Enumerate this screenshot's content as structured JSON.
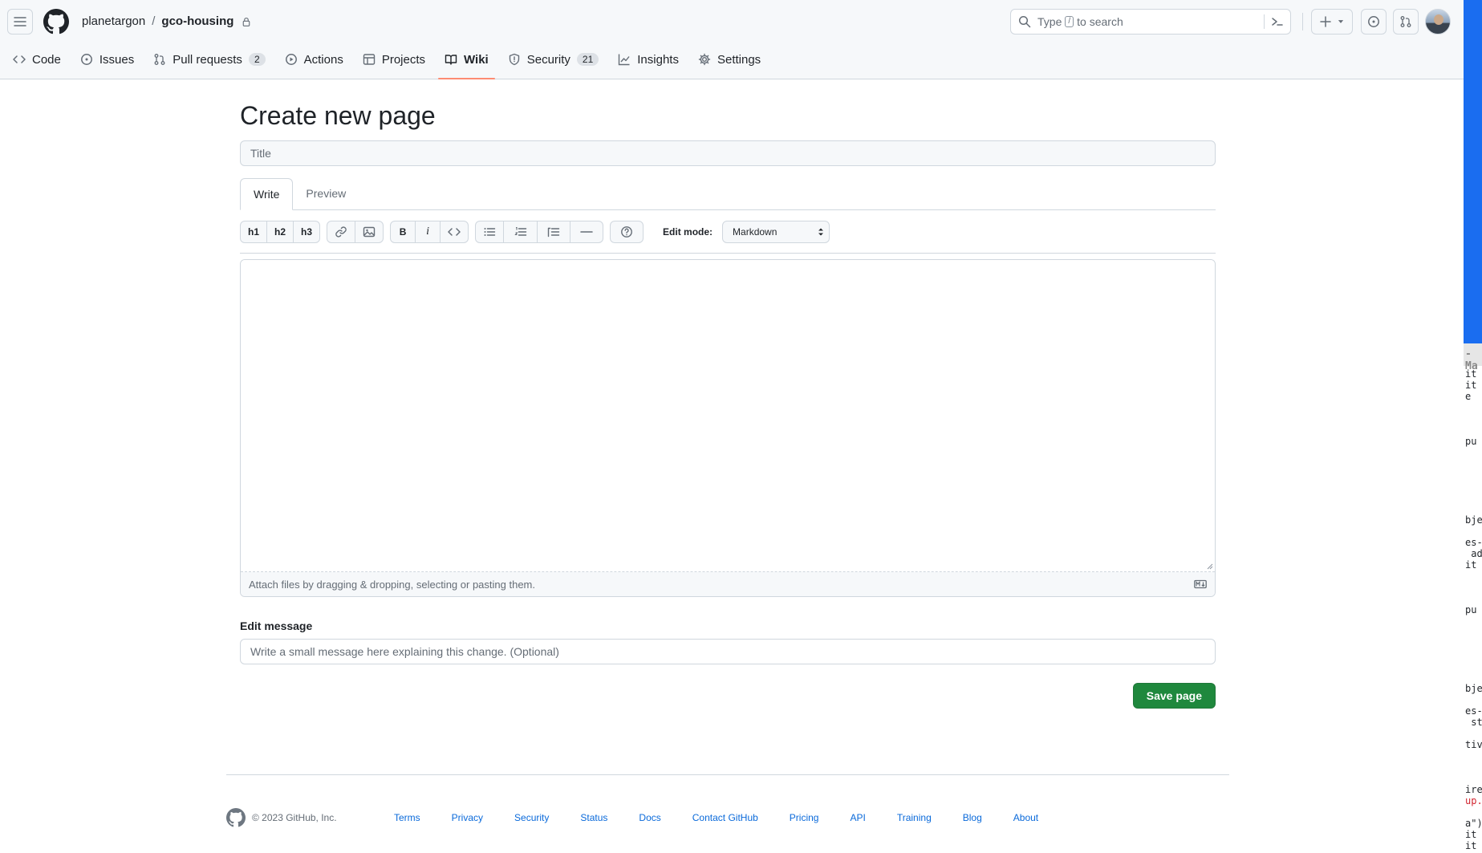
{
  "header": {
    "owner": "planetargon",
    "separator": "/",
    "repo": "gco-housing",
    "search": {
      "prefix": "Type",
      "key": "/",
      "suffix": "to search"
    }
  },
  "tabs": [
    {
      "label": "Code",
      "icon": "code-icon"
    },
    {
      "label": "Issues",
      "icon": "issue-icon"
    },
    {
      "label": "Pull requests",
      "icon": "pull-request-icon",
      "count": "2"
    },
    {
      "label": "Actions",
      "icon": "play-icon"
    },
    {
      "label": "Projects",
      "icon": "table-icon"
    },
    {
      "label": "Wiki",
      "icon": "book-icon",
      "selected": true
    },
    {
      "label": "Security",
      "icon": "shield-icon",
      "count": "21"
    },
    {
      "label": "Insights",
      "icon": "graph-icon"
    },
    {
      "label": "Settings",
      "icon": "gear-icon"
    }
  ],
  "main": {
    "title": "Create new page",
    "title_placeholder": "Title",
    "editor_tabs": {
      "write": "Write",
      "preview": "Preview"
    },
    "toolbar": {
      "h1": "h1",
      "h2": "h2",
      "h3": "h3",
      "bold": "B",
      "italic": "i",
      "edit_mode_label": "Edit mode:",
      "edit_mode_value": "Markdown"
    },
    "attach_text": "Attach files by dragging & dropping, selecting or pasting them.",
    "edit_message_label": "Edit message",
    "edit_message_placeholder": "Write a small message here explaining this change. (Optional)",
    "save_label": "Save page"
  },
  "footer": {
    "copyright": "© 2023 GitHub, Inc.",
    "links": [
      "Terms",
      "Privacy",
      "Security",
      "Status",
      "Docs",
      "Contact GitHub",
      "Pricing",
      "API",
      "Training",
      "Blog",
      "About"
    ]
  },
  "background_window": {
    "bar_text": "-Ma",
    "lines": [
      "it",
      "it",
      "e",
      "pu",
      "bje",
      "es-",
      " ad",
      "it",
      "pu",
      "bje",
      "es-",
      " st",
      "tiv",
      "ire",
      "up.",
      "a\")",
      "it",
      "it"
    ]
  },
  "colors": {
    "accent": "#1f883d",
    "link": "#0969da",
    "tab_underline": "#fd8c73"
  }
}
